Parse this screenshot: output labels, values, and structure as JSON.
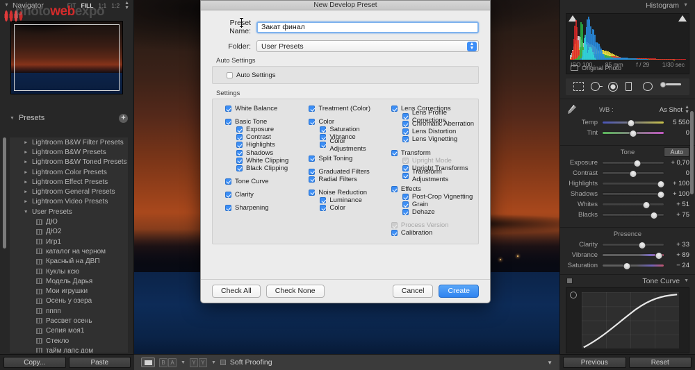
{
  "app": {
    "watermark": {
      "pre": "photo",
      "hl": "web",
      "post": "expo"
    }
  },
  "navigator": {
    "title": "Navigator",
    "zoom_levels": [
      "FIT",
      "FILL",
      "1:1",
      "1:2"
    ],
    "active_zoom": "FILL"
  },
  "presets": {
    "title": "Presets",
    "add_label": "+",
    "items": [
      {
        "label": "Lightroom B&W Filter Presets",
        "type": "folder",
        "expanded": false
      },
      {
        "label": "Lightroom B&W Presets",
        "type": "folder",
        "expanded": false
      },
      {
        "label": "Lightroom B&W Toned Presets",
        "type": "folder",
        "expanded": false
      },
      {
        "label": "Lightroom Color Presets",
        "type": "folder",
        "expanded": false
      },
      {
        "label": "Lightroom Effect Presets",
        "type": "folder",
        "expanded": false
      },
      {
        "label": "Lightroom General Presets",
        "type": "folder",
        "expanded": false
      },
      {
        "label": "Lightroom Video Presets",
        "type": "folder",
        "expanded": false
      },
      {
        "label": "User Presets",
        "type": "folder",
        "expanded": true
      },
      {
        "label": "ДЮ",
        "type": "preset"
      },
      {
        "label": "ДЮ2",
        "type": "preset"
      },
      {
        "label": "Игр1",
        "type": "preset"
      },
      {
        "label": "каталог на черном",
        "type": "preset"
      },
      {
        "label": "Красный на ДВП",
        "type": "preset"
      },
      {
        "label": "Куклы ксю",
        "type": "preset"
      },
      {
        "label": "Модель Дарья",
        "type": "preset"
      },
      {
        "label": "Мои игрушки",
        "type": "preset"
      },
      {
        "label": "Осень у озера",
        "type": "preset"
      },
      {
        "label": "пппп",
        "type": "preset"
      },
      {
        "label": "Рассвет осень",
        "type": "preset"
      },
      {
        "label": "Сепия моя1",
        "type": "preset"
      },
      {
        "label": "Стекло",
        "type": "preset"
      },
      {
        "label": "тайм лапс дом",
        "type": "preset"
      }
    ]
  },
  "left_bottom": {
    "copy_label": "Copy...",
    "paste_label": "Paste"
  },
  "toolbar": {
    "view_icon": "single-view-icon",
    "compare_icon": "compare-view-icon",
    "survey_icon": "before-after-icon",
    "soft_proofing_label": "Soft Proofing",
    "soft_proofing_checked": false,
    "collapse_icon": "chevron-down-icon"
  },
  "histogram": {
    "title": "Histogram",
    "iso": "ISO 100",
    "focal": "85 mm",
    "aperture": "f / 29",
    "shutter": "1/30 sec",
    "original_photo_label": "Original Photo",
    "clipping_shadows_on": true,
    "clipping_highlights_on": true
  },
  "tool_strip": {
    "tools": [
      "crop-overlay-icon",
      "spot-removal-icon",
      "red-eye-icon",
      "graduated-filter-icon",
      "radial-filter-icon",
      "adjustment-brush-icon"
    ]
  },
  "basic_panel": {
    "wb_label": "WB :",
    "wb_value": "As Shot",
    "eyedropper_icon": "white-balance-selector-icon",
    "tone_title": "Tone",
    "auto_label": "Auto",
    "presence_title": "Presence",
    "sliders": [
      {
        "name": "Temp",
        "value": "5 550",
        "pos": 47,
        "track": "temp"
      },
      {
        "name": "Tint",
        "value": "0",
        "pos": 50,
        "track": "tint"
      },
      {
        "name": "Exposure",
        "value": "+ 0,70",
        "pos": 57,
        "track": "plain"
      },
      {
        "name": "Contrast",
        "value": "0",
        "pos": 50,
        "track": "plain"
      },
      {
        "name": "Highlights",
        "value": "+ 100",
        "pos": 96,
        "track": "plain"
      },
      {
        "name": "Shadows",
        "value": "+ 100",
        "pos": 96,
        "track": "plain"
      },
      {
        "name": "Whites",
        "value": "+ 51",
        "pos": 72,
        "track": "plain"
      },
      {
        "name": "Blacks",
        "value": "+ 75",
        "pos": 84,
        "track": "plain"
      },
      {
        "name": "Clarity",
        "value": "+ 33",
        "pos": 65,
        "track": "plain"
      },
      {
        "name": "Vibrance",
        "value": "+ 89",
        "pos": 92,
        "track": "vib"
      },
      {
        "name": "Saturation",
        "value": "− 24",
        "pos": 40,
        "track": "sat"
      }
    ]
  },
  "tone_curve": {
    "title": "Tone Curve",
    "target_icon": "targeted-adjustment-icon"
  },
  "right_bottom": {
    "previous_label": "Previous",
    "reset_label": "Reset"
  },
  "dialog": {
    "title": "New Develop Preset",
    "preset_name_label": "Preset Name:",
    "preset_name_value": "Закат финал",
    "folder_label": "Folder:",
    "folder_value": "User Presets",
    "auto_settings_group": "Auto Settings",
    "auto_settings_label": "Auto Settings",
    "auto_settings_checked": false,
    "settings_group": "Settings",
    "columns": [
      [
        {
          "label": "White Balance",
          "state": "on",
          "indent": 0,
          "gap": 0
        },
        {
          "label": "Basic Tone",
          "state": "on",
          "indent": 0,
          "gap": 1
        },
        {
          "label": "Exposure",
          "state": "on",
          "indent": 1,
          "gap": 0
        },
        {
          "label": "Contrast",
          "state": "on",
          "indent": 1,
          "gap": 0
        },
        {
          "label": "Highlights",
          "state": "on",
          "indent": 1,
          "gap": 0
        },
        {
          "label": "Shadows",
          "state": "on",
          "indent": 1,
          "gap": 0
        },
        {
          "label": "White Clipping",
          "state": "on",
          "indent": 1,
          "gap": 0
        },
        {
          "label": "Black Clipping",
          "state": "on",
          "indent": 1,
          "gap": 0
        },
        {
          "label": "Tone Curve",
          "state": "on",
          "indent": 0,
          "gap": 1
        },
        {
          "label": "Clarity",
          "state": "on",
          "indent": 0,
          "gap": 1
        },
        {
          "label": "Sharpening",
          "state": "on",
          "indent": 0,
          "gap": 1
        }
      ],
      [
        {
          "label": "Treatment (Color)",
          "state": "on",
          "indent": 0,
          "gap": 0
        },
        {
          "label": "Color",
          "state": "on",
          "indent": 0,
          "gap": 1
        },
        {
          "label": "Saturation",
          "state": "on",
          "indent": 1,
          "gap": 0
        },
        {
          "label": "Vibrance",
          "state": "on",
          "indent": 1,
          "gap": 0
        },
        {
          "label": "Color Adjustments",
          "state": "on",
          "indent": 1,
          "gap": 0
        },
        {
          "label": "Split Toning",
          "state": "on",
          "indent": 0,
          "gap": 1
        },
        {
          "label": "Graduated Filters",
          "state": "on",
          "indent": 0,
          "gap": 1
        },
        {
          "label": "Radial Filters",
          "state": "on",
          "indent": 0,
          "gap": 0
        },
        {
          "label": "Noise Reduction",
          "state": "on",
          "indent": 0,
          "gap": 1
        },
        {
          "label": "Luminance",
          "state": "on",
          "indent": 1,
          "gap": 0
        },
        {
          "label": "Color",
          "state": "on",
          "indent": 1,
          "gap": 0
        }
      ],
      [
        {
          "label": "Lens Corrections",
          "state": "on",
          "indent": 0,
          "gap": 0
        },
        {
          "label": "Lens Profile Corrections",
          "state": "on",
          "indent": 1,
          "gap": 0
        },
        {
          "label": "Chromatic Aberration",
          "state": "on",
          "indent": 1,
          "gap": 0
        },
        {
          "label": "Lens Distortion",
          "state": "on",
          "indent": 1,
          "gap": 0
        },
        {
          "label": "Lens Vignetting",
          "state": "on",
          "indent": 1,
          "gap": 0
        },
        {
          "label": "Transform",
          "state": "on",
          "indent": 0,
          "gap": 1
        },
        {
          "label": "Upright Mode",
          "state": "dim",
          "indent": 1,
          "gap": 0
        },
        {
          "label": "Upright Transforms",
          "state": "on",
          "indent": 1,
          "gap": 0
        },
        {
          "label": "Transform Adjustments",
          "state": "on",
          "indent": 1,
          "gap": 0
        },
        {
          "label": "Effects",
          "state": "on",
          "indent": 0,
          "gap": 1
        },
        {
          "label": "Post-Crop Vignetting",
          "state": "on",
          "indent": 1,
          "gap": 0
        },
        {
          "label": "Grain",
          "state": "on",
          "indent": 1,
          "gap": 0
        },
        {
          "label": "Dehaze",
          "state": "on",
          "indent": 1,
          "gap": 0
        },
        {
          "label": "Process Version",
          "state": "dim",
          "indent": 0,
          "gap": 1
        },
        {
          "label": "Calibration",
          "state": "on",
          "indent": 0,
          "gap": 0
        }
      ]
    ],
    "check_all_label": "Check All",
    "check_none_label": "Check None",
    "cancel_label": "Cancel",
    "create_label": "Create"
  },
  "colors": {
    "accent": "#3c8ef5",
    "panel": "#272727",
    "dialog": "#ececec",
    "brand_red": "#d32b2b"
  }
}
